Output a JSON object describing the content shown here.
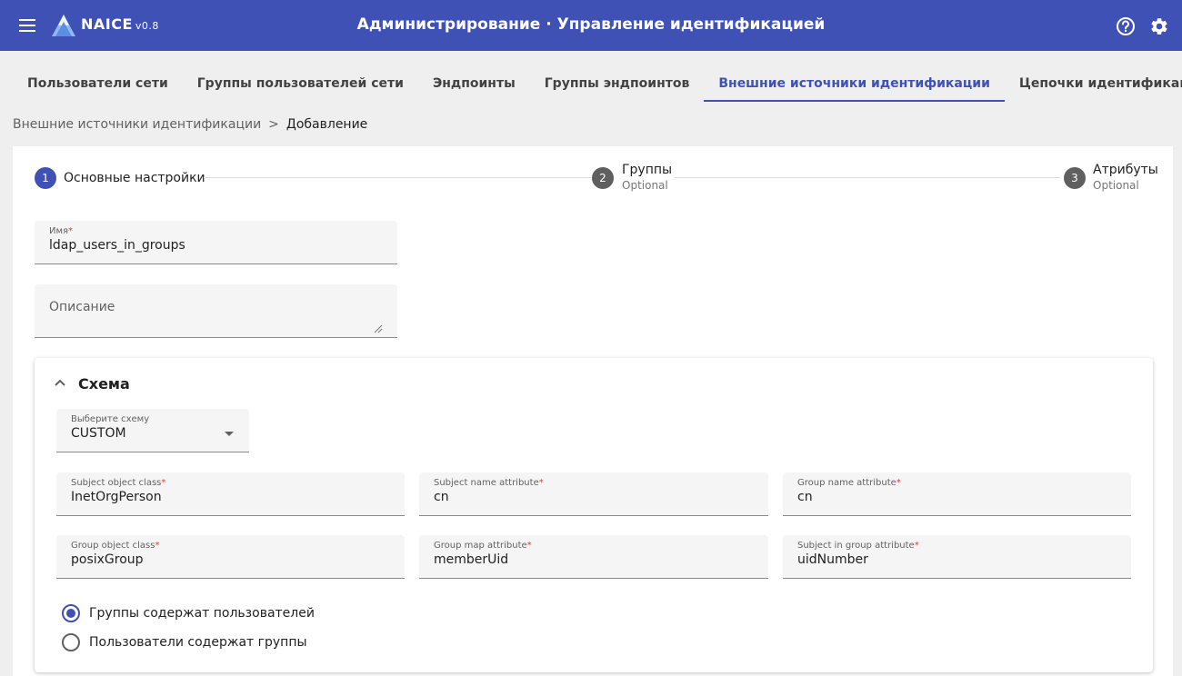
{
  "app": {
    "brand": "NAICE",
    "version": "v0.8",
    "page_title": "Администрирование · Управление идентификацией"
  },
  "icons": {
    "menu": "menu-icon",
    "logo": "naice-logo-icon",
    "help": "help-circle-icon",
    "settings": "gear-icon",
    "collapse": "chevron-up-icon",
    "dropdown": "caret-down-icon",
    "resize": "resize-handle-icon"
  },
  "colors": {
    "primary": "#3f51b5",
    "required": "#e53935"
  },
  "tabs": [
    {
      "label": "Пользователи сети",
      "active": false
    },
    {
      "label": "Группы пользователей сети",
      "active": false
    },
    {
      "label": "Эндпоинты",
      "active": false
    },
    {
      "label": "Группы эндпоинтов",
      "active": false
    },
    {
      "label": "Внешние источники идентификации",
      "active": true
    },
    {
      "label": "Цепочки идентификаций",
      "active": false
    }
  ],
  "breadcrumb": {
    "parent": "Внешние источники идентификации",
    "separator": ">",
    "current": "Добавление"
  },
  "stepper": [
    {
      "num": "1",
      "label": "Основные настройки",
      "sub": "",
      "active": true
    },
    {
      "num": "2",
      "label": "Группы",
      "sub": "Optional",
      "active": false
    },
    {
      "num": "3",
      "label": "Атрибуты",
      "sub": "Optional",
      "active": false
    }
  ],
  "form": {
    "name": {
      "label": "Имя",
      "required": "*",
      "value": "ldap_users_in_groups"
    },
    "description": {
      "placeholder": "Описание",
      "value": ""
    }
  },
  "schema": {
    "title": "Схема",
    "select": {
      "label": "Выберите схему",
      "value": "CUSTOM"
    },
    "fields": {
      "subject_object_class": {
        "label": "Subject object class",
        "required": "*",
        "value": "InetOrgPerson"
      },
      "subject_name_attribute": {
        "label": "Subject name attribute",
        "required": "*",
        "value": "cn"
      },
      "group_name_attribute": {
        "label": "Group name attribute",
        "required": "*",
        "value": "cn"
      },
      "group_object_class": {
        "label": "Group object class",
        "required": "*",
        "value": "posixGroup"
      },
      "group_map_attribute": {
        "label": "Group map attribute",
        "required": "*",
        "value": "memberUid"
      },
      "subject_in_group_attribute": {
        "label": "Subject in group attribute",
        "required": "*",
        "value": "uidNumber"
      }
    },
    "radios": [
      {
        "label": "Группы содержат пользователей",
        "checked": true
      },
      {
        "label": "Пользователи содержат группы",
        "checked": false
      }
    ]
  }
}
